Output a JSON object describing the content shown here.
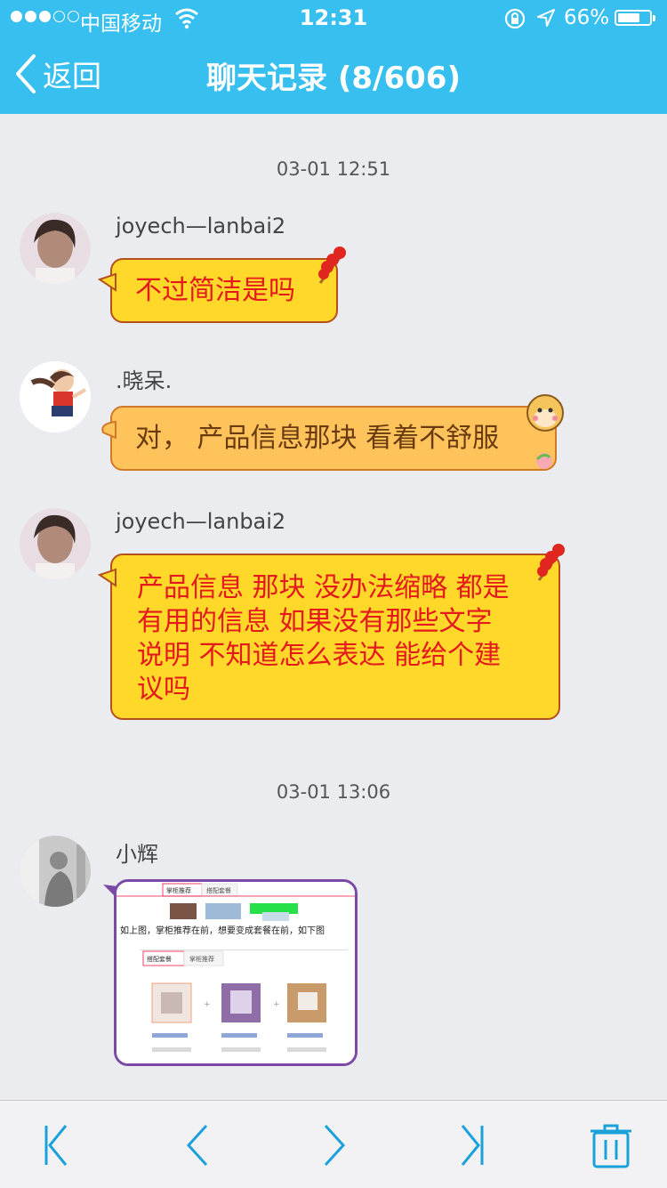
{
  "status_bar": {
    "carrier": "中国移动",
    "time": "12:31",
    "battery_percent": "66%",
    "battery_level": 0.66
  },
  "nav": {
    "back_label": "返回",
    "title": "聊天记录 (8/606)"
  },
  "messages": [
    {
      "timestamp": "03-01 12:51",
      "sender": "joyech—lanbai2",
      "text": "不过简洁是吗",
      "bubble_color": "#ffd82a"
    },
    {
      "sender": ".晓呆.",
      "text": "对，  产品信息那块 看着不舒服",
      "bubble_color": "#ffc35c"
    },
    {
      "sender": "joyech—lanbai2",
      "lines": [
        "产品信息 那块 没办法缩略 都是",
        "有用的信息 如果没有那些文字",
        "说明 不知道怎么表达 能给个建",
        "议吗"
      ],
      "bubble_color": "#ffd82a"
    },
    {
      "timestamp": "03-01 13:06",
      "sender": "小辉",
      "image": {
        "tabs_top": [
          "掌柜推荐",
          "搭配套餐"
        ],
        "caption": "如上图，掌柜推荐在前，想要变成套餐在前，如下图",
        "tabs_bottom": [
          "搭配套餐",
          "掌柜推荐"
        ]
      }
    }
  ],
  "toolbar": {
    "icons": [
      "first-page-icon",
      "previous-page-icon",
      "next-page-icon",
      "last-page-icon",
      "trash-icon"
    ],
    "accent": "#1ba1d9"
  },
  "colors": {
    "header": "#37bff0",
    "background": "#ebecf0",
    "message_text": "#e3191b"
  }
}
